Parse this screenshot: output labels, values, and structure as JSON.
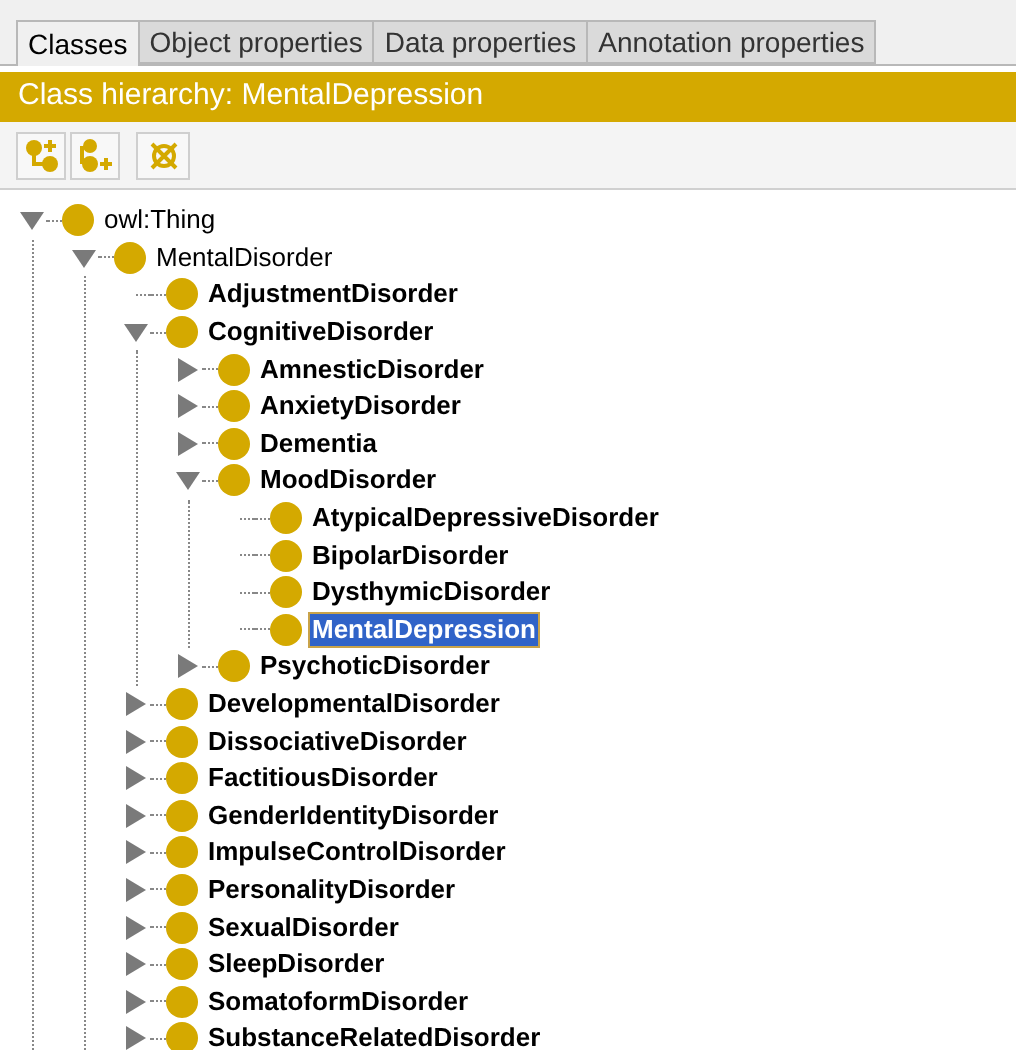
{
  "tabs": [
    {
      "label": "Classes",
      "selected": true
    },
    {
      "label": "Object properties",
      "selected": false
    },
    {
      "label": "Data properties",
      "selected": false
    },
    {
      "label": "Annotation properties",
      "selected": false
    }
  ],
  "header": {
    "title": "Class hierarchy: MentalDepression"
  },
  "tree": [
    {
      "label": "owl:Thing",
      "kind": "branch",
      "expanded": true,
      "bold": false,
      "selected": false,
      "children": [
        {
          "label": "MentalDisorder",
          "kind": "branch",
          "expanded": true,
          "bold": false,
          "selected": false,
          "children": [
            {
              "label": "AdjustmentDisorder",
              "kind": "leaf",
              "bold": true,
              "selected": false
            },
            {
              "label": "CognitiveDisorder",
              "kind": "branch",
              "expanded": true,
              "bold": true,
              "selected": false,
              "children": [
                {
                  "label": "AmnesticDisorder",
                  "kind": "branch",
                  "expanded": false,
                  "bold": true,
                  "selected": false
                },
                {
                  "label": "AnxietyDisorder",
                  "kind": "branch",
                  "expanded": false,
                  "bold": true,
                  "selected": false
                },
                {
                  "label": "Dementia",
                  "kind": "branch",
                  "expanded": false,
                  "bold": true,
                  "selected": false
                },
                {
                  "label": "MoodDisorder",
                  "kind": "branch",
                  "expanded": true,
                  "bold": true,
                  "selected": false,
                  "children": [
                    {
                      "label": "AtypicalDepressiveDisorder",
                      "kind": "leaf",
                      "bold": true,
                      "selected": false
                    },
                    {
                      "label": "BipolarDisorder",
                      "kind": "leaf",
                      "bold": true,
                      "selected": false
                    },
                    {
                      "label": "DysthymicDisorder",
                      "kind": "leaf",
                      "bold": true,
                      "selected": false
                    },
                    {
                      "label": "MentalDepression",
                      "kind": "leaf",
                      "bold": true,
                      "selected": true
                    }
                  ]
                },
                {
                  "label": "PsychoticDisorder",
                  "kind": "branch",
                  "expanded": false,
                  "bold": true,
                  "selected": false
                }
              ]
            },
            {
              "label": "DevelopmentalDisorder",
              "kind": "branch",
              "expanded": false,
              "bold": true,
              "selected": false
            },
            {
              "label": "DissociativeDisorder",
              "kind": "branch",
              "expanded": false,
              "bold": true,
              "selected": false
            },
            {
              "label": "FactitiousDisorder",
              "kind": "branch",
              "expanded": false,
              "bold": true,
              "selected": false
            },
            {
              "label": "GenderIdentityDisorder",
              "kind": "branch",
              "expanded": false,
              "bold": true,
              "selected": false
            },
            {
              "label": "ImpulseControlDisorder",
              "kind": "branch",
              "expanded": false,
              "bold": true,
              "selected": false
            },
            {
              "label": "PersonalityDisorder",
              "kind": "branch",
              "expanded": false,
              "bold": true,
              "selected": false
            },
            {
              "label": "SexualDisorder",
              "kind": "branch",
              "expanded": false,
              "bold": true,
              "selected": false
            },
            {
              "label": "SleepDisorder",
              "kind": "branch",
              "expanded": false,
              "bold": true,
              "selected": false
            },
            {
              "label": "SomatoformDisorder",
              "kind": "branch",
              "expanded": false,
              "bold": true,
              "selected": false
            },
            {
              "label": "SubstanceRelatedDisorder",
              "kind": "branch",
              "expanded": false,
              "bold": true,
              "selected": false
            }
          ]
        }
      ]
    }
  ]
}
